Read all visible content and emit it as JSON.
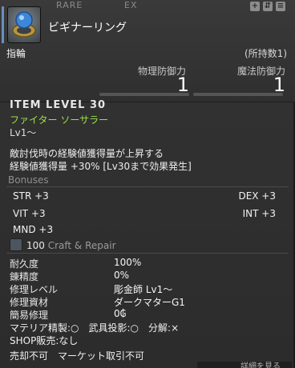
{
  "header": {
    "rarity_label": "RARE",
    "ex_label": "EX",
    "item_name": "ビギナーリング",
    "category": "指輪",
    "owned": "(所持数1)",
    "icons": [
      "plus-icon",
      "compare-icon",
      "lock-icon"
    ]
  },
  "stats": {
    "physical_defense_label": "物理防御力",
    "physical_defense_value": "1",
    "magic_defense_label": "魔法防御力",
    "magic_defense_value": "1"
  },
  "item_level": "ITEM LEVEL 30",
  "jobs": "ファイター ソーサラー",
  "level_req": "Lv1〜",
  "description": [
    "敵討伐時の経験値獲得量が上昇する",
    "経験値獲得量 +30% [Lv30まで効果発生]"
  ],
  "bonuses": {
    "title": "Bonuses",
    "items": [
      {
        "label": "STR +3"
      },
      {
        "label": "DEX +3"
      },
      {
        "label": "VIT +3"
      },
      {
        "label": "INT +3"
      },
      {
        "label": "MND +3"
      }
    ]
  },
  "craft": {
    "level": "100",
    "title": "Craft & Repair",
    "rows": [
      {
        "label": "耐久度",
        "value": "100%"
      },
      {
        "label": "錬精度",
        "value": "0%"
      },
      {
        "label": "修理レベル",
        "value": "彫金師 Lv1〜"
      },
      {
        "label": "修理資材",
        "value": "ダークマターG1"
      },
      {
        "label": "簡易修理",
        "value": "0₲"
      }
    ]
  },
  "footer": {
    "line1": "マテリア精製:○　武具投影:○　分解:×",
    "line2": "SHOP販売:なし",
    "line3": "売却不可　マーケット取引不可"
  },
  "bottom_strip_text": "詳細を見る"
}
